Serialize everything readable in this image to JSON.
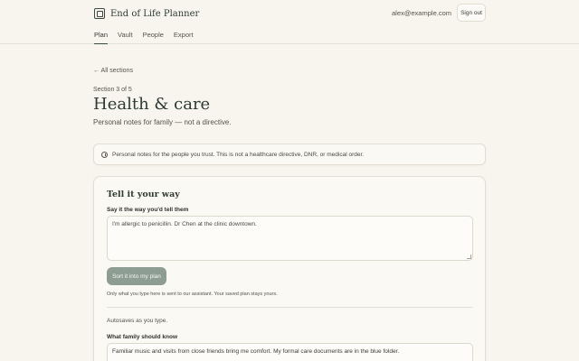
{
  "header": {
    "app_title": "End of Life Planner",
    "brand_icon": "planner-logo-icon",
    "account_email": "alex@example.com",
    "signout_label": "Sign out"
  },
  "nav": {
    "items": [
      {
        "label": "Plan",
        "active": true
      },
      {
        "label": "Vault",
        "active": false
      },
      {
        "label": "People",
        "active": false
      },
      {
        "label": "Export",
        "active": false
      }
    ]
  },
  "page": {
    "back_link": "← All sections",
    "section_label": "Section 3 of 5",
    "title": "Health & care",
    "subtitle": "Personal notes for family — not a directive."
  },
  "notice": {
    "icon": "info-icon",
    "text": "Personal notes for the people you trust. This is not a healthcare directive, DNR, or medical order."
  },
  "card": {
    "title": "Tell it your way",
    "say_label": "Say it the way you'd tell them",
    "say_value": "I'm allergic to penicillin. Dr Chen at the clinic downtown.",
    "sort_button": "Sort it into my plan",
    "privacy_note": "Only what you type here is sent to our assistant. Your saved plan stays yours.",
    "autosave": "Autosaves as you type.",
    "family_label": "What family should know",
    "family_value": "Familiar music and visits from close friends bring me comfort. My formal care documents are in the blue folder."
  },
  "colors": {
    "background": "#f8f5ef",
    "accent": "#3d4a42",
    "button": "#8e9d94"
  }
}
